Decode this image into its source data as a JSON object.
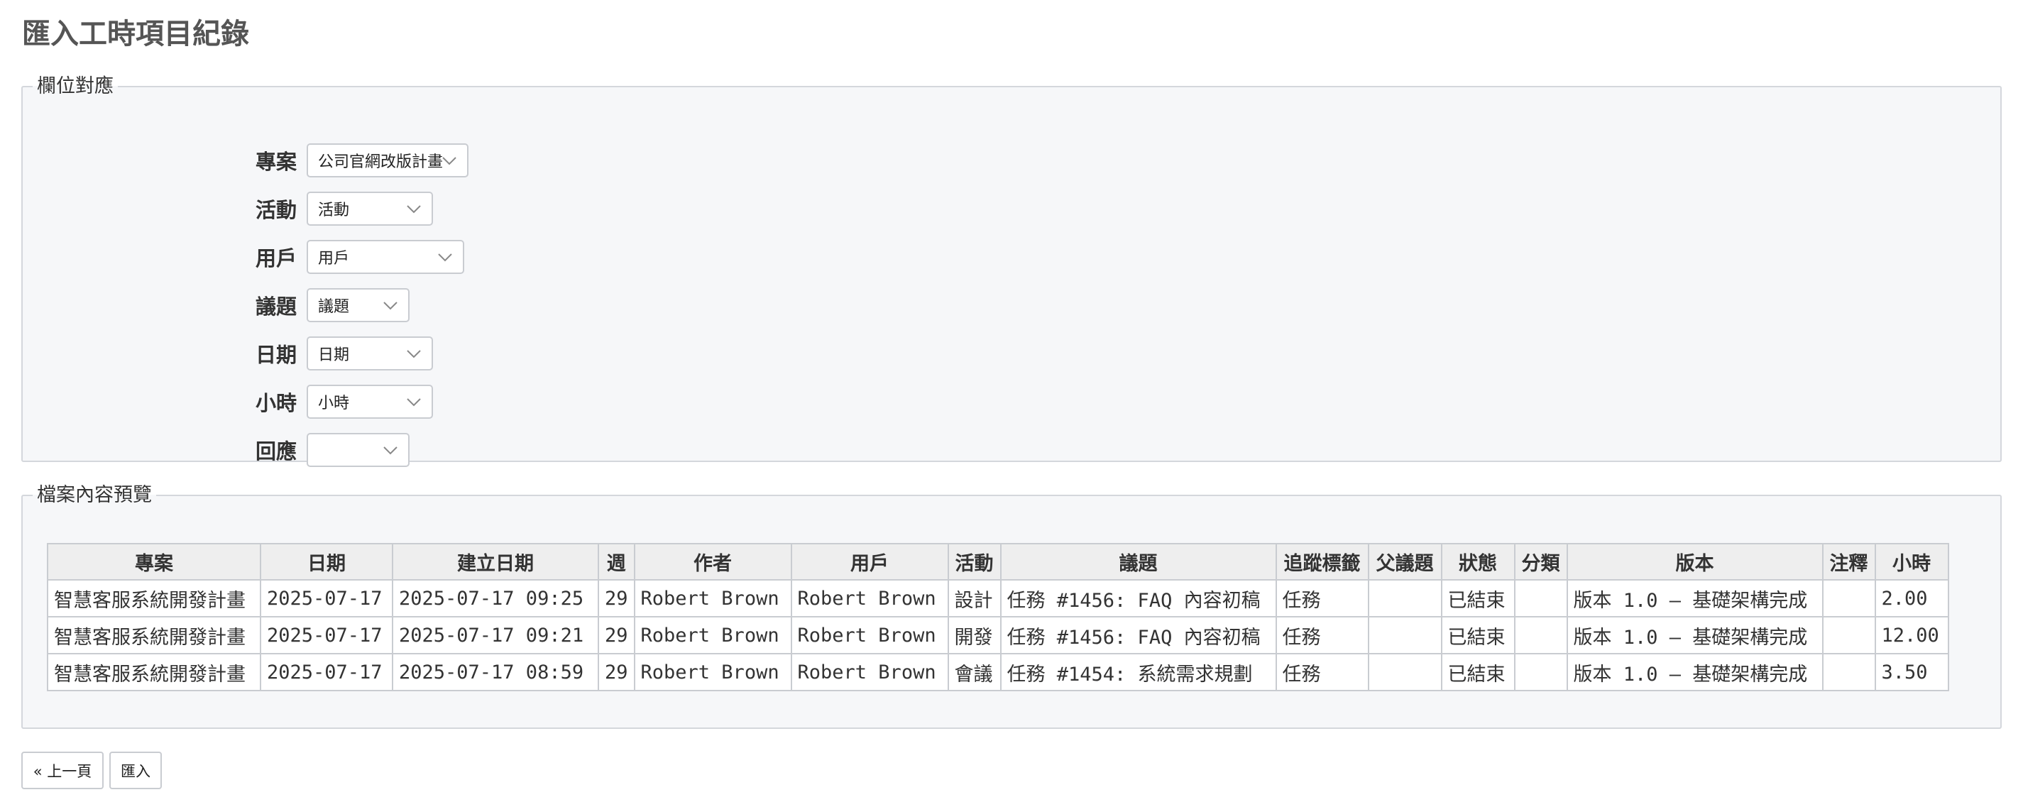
{
  "page": {
    "title": "匯入工時項目紀錄"
  },
  "mapping": {
    "legend": "欄位對應",
    "fields": [
      {
        "label": "專案",
        "selected": "公司官網改版計畫"
      },
      {
        "label": "活動",
        "selected": "活動"
      },
      {
        "label": "用戶",
        "selected": "用戶"
      },
      {
        "label": "議題",
        "selected": "議題"
      },
      {
        "label": "日期",
        "selected": "日期"
      },
      {
        "label": "小時",
        "selected": "小時"
      },
      {
        "label": "回應",
        "selected": ""
      }
    ]
  },
  "preview": {
    "legend": "檔案內容預覽",
    "columns": [
      "專案",
      "日期",
      "建立日期",
      "週",
      "作者",
      "用戶",
      "活動",
      "議題",
      "追蹤標籤",
      "父議題",
      "狀態",
      "分類",
      "版本",
      "注釋",
      "小時"
    ],
    "rows": [
      [
        "智慧客服系統開發計畫",
        "2025-07-17",
        "2025-07-17 09:25",
        "29",
        "Robert Brown",
        "Robert Brown",
        "設計",
        "任務 #1456: FAQ 內容初稿",
        "任務",
        "",
        "已結束",
        "",
        "版本 1.0 – 基礎架構完成",
        "",
        "2.00"
      ],
      [
        "智慧客服系統開發計畫",
        "2025-07-17",
        "2025-07-17 09:21",
        "29",
        "Robert Brown",
        "Robert Brown",
        "開發",
        "任務 #1456: FAQ 內容初稿",
        "任務",
        "",
        "已結束",
        "",
        "版本 1.0 – 基礎架構完成",
        "",
        "12.00"
      ],
      [
        "智慧客服系統開發計畫",
        "2025-07-17",
        "2025-07-17 08:59",
        "29",
        "Robert Brown",
        "Robert Brown",
        "會議",
        "任務 #1454: 系統需求規劃",
        "任務",
        "",
        "已結束",
        "",
        "版本 1.0 – 基礎架構完成",
        "",
        "3.50"
      ]
    ]
  },
  "actions": {
    "previous_label": "« 上一頁",
    "import_label": "匯入"
  },
  "icons": {
    "select_arrow": "chevron-down-icon"
  },
  "colors": {
    "panel_bg": "#f6f7f9",
    "border": "#c9ccd1",
    "header_bg": "#eeeeee",
    "title": "#555555"
  }
}
